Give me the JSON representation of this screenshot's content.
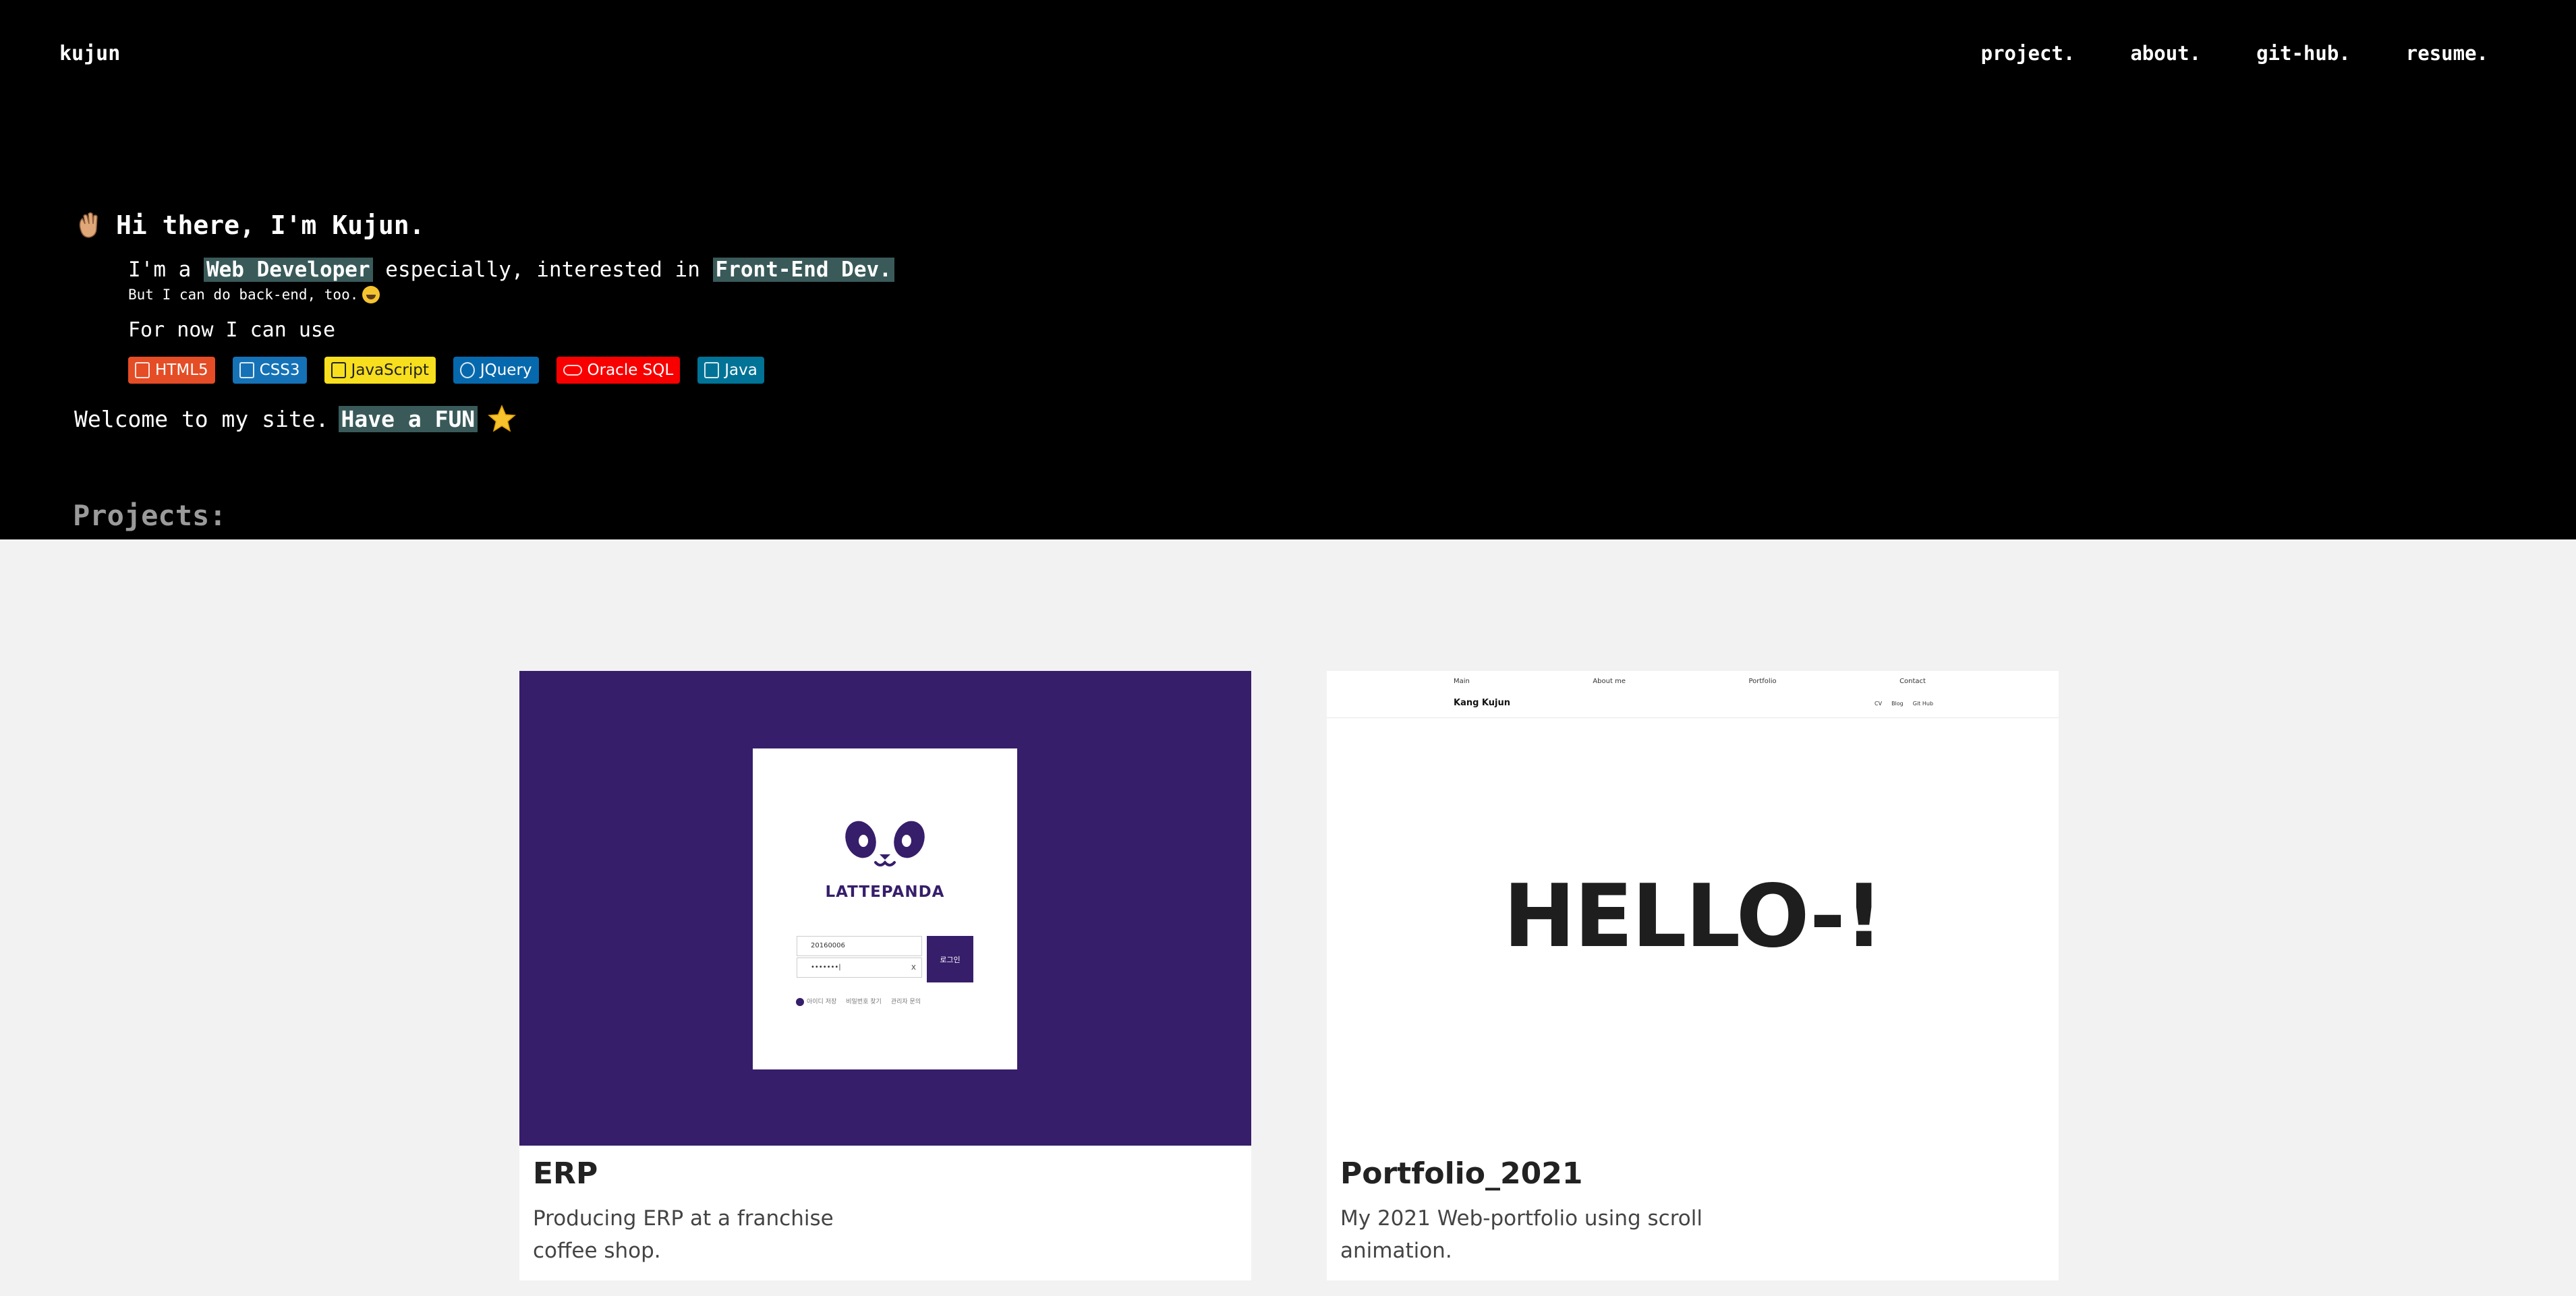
{
  "header": {
    "brand": "kujun",
    "nav": [
      "project.",
      "about.",
      "git-hub.",
      "resume."
    ]
  },
  "intro": {
    "greeting": "Hi there, I'm Kujun.",
    "line1_pre": "I'm a ",
    "line1_hl1": "Web Developer",
    "line1_mid": " especially, interested in ",
    "line1_hl2": "Front-End Dev.",
    "line2": "But I can do back-end, too.",
    "for_now": "For now I can use",
    "badges": [
      {
        "label": "HTML5",
        "color": "#e44d26"
      },
      {
        "label": "CSS3",
        "color": "#1572b6"
      },
      {
        "label": "JavaScript",
        "color": "#f7df1e"
      },
      {
        "label": "JQuery",
        "color": "#0769ad"
      },
      {
        "label": "Oracle SQL",
        "color": "#f80000"
      },
      {
        "label": "Java",
        "color": "#007396"
      }
    ],
    "welcome_pre": "Welcome to my site.",
    "welcome_hl": "Have a FUN"
  },
  "projects": {
    "heading": "Projects:",
    "items": [
      {
        "title": "ERP",
        "description": "Producing ERP at a franchise coffee shop.",
        "preview": {
          "brand": "LATTEPANDA",
          "id_value": "20160006",
          "pw_value": "•••••••|",
          "pw_clear": "x",
          "login_label": "로그인",
          "links": [
            "아이디 저장",
            "비밀번호 찾기",
            "관리자 문의"
          ]
        }
      },
      {
        "title": "Portfolio_2021",
        "description": "My 2021 Web-portfolio using scroll animation.",
        "preview": {
          "nav": [
            "Main",
            "About me",
            "Portfolio",
            "Contact"
          ],
          "name": "Kang Kujun",
          "right_links": [
            "CV",
            "Blog",
            "Git Hub"
          ],
          "hero": "HELLO-!"
        }
      }
    ]
  },
  "colors": {
    "background": "#000000",
    "highlight": "#3a5a5a",
    "gallery_bg": "#f2f2f2",
    "erp_purple": "#361e6b",
    "heading_gray": "#9a9a9a"
  },
  "icons": [
    "waving-hand-icon",
    "grinning-face-icon",
    "star-icon",
    "panda-logo-icon"
  ]
}
